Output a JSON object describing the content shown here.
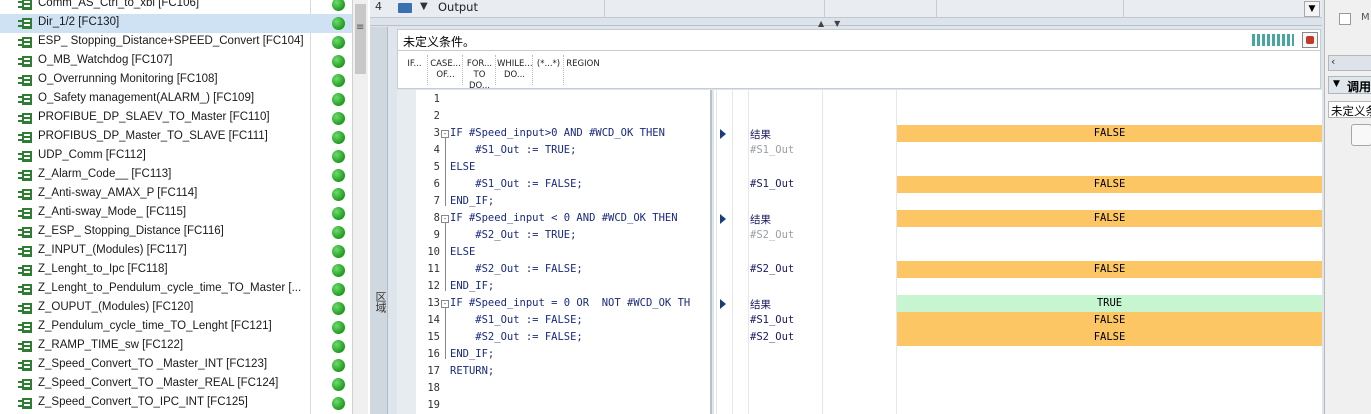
{
  "project_tree": {
    "items": [
      {
        "label": "Comm_AS_Ctrl_to_xbl [FC106]"
      },
      {
        "label": "Dir_1/2 [FC130]"
      },
      {
        "label": "ESP_ Stopping_Distance+SPEED_Convert [FC104]"
      },
      {
        "label": "O_MB_Watchdog [FC107]"
      },
      {
        "label": "O_Overrunning Monitoring [FC108]"
      },
      {
        "label": "O_Safety management(ALARM_) [FC109]"
      },
      {
        "label": "PROFIBUE_DP_SLAEV_TO_Master [FC110]"
      },
      {
        "label": "PROFIBUS_DP_Master_TO_SLAVE [FC111]"
      },
      {
        "label": "UDP_Comm [FC112]"
      },
      {
        "label": "Z_Alarm_Code__ [FC113]"
      },
      {
        "label": "Z_Anti-sway_AMAX_P [FC114]"
      },
      {
        "label": "Z_Anti-sway_Mode_ [FC115]"
      },
      {
        "label": "Z_ESP_ Stopping_Distance [FC116]"
      },
      {
        "label": "Z_INPUT_(Modules) [FC117]"
      },
      {
        "label": "Z_Lenght_to_Ipc [FC118]"
      },
      {
        "label": "Z_Lenght_to_Pendulum_cycle_time_TO_Master [..."
      },
      {
        "label": "Z_OUPUT_(Modules) [FC120]"
      },
      {
        "label": "Z_Pendulum_cycle_time_TO_Lenght [FC121]"
      },
      {
        "label": "Z_RAMP_TIME_sw [FC122]"
      },
      {
        "label": "Z_Speed_Convert_TO _Master_INT [FC123]"
      },
      {
        "label": "Z_Speed_Convert_TO _Master_REAL [FC124]"
      },
      {
        "label": "Z_Speed_Convert_TO_IPC_INT [FC125]"
      }
    ],
    "selected_index": 1,
    "status_color": "#1e9a1e",
    "block_icon": "function-block-icon"
  },
  "interface": {
    "row_number": "4",
    "section_label": "Output"
  },
  "editor": {
    "side_label": "区域",
    "block_comment": "未定义条件。",
    "instructions": [
      {
        "label": "IF..."
      },
      {
        "label": "CASE... OF..."
      },
      {
        "label": "FOR... TO DO..."
      },
      {
        "label": "WHILE... DO..."
      },
      {
        "label": "(*...*)"
      },
      {
        "label": "REGION"
      }
    ],
    "code_lines": [
      {
        "no": "1",
        "text": ""
      },
      {
        "no": "2",
        "text": ""
      },
      {
        "no": "3",
        "text": "IF #Speed_input>0 AND #WCD_OK THEN",
        "fold": "-"
      },
      {
        "no": "4",
        "text": "    #S1_Out := TRUE;"
      },
      {
        "no": "5",
        "text": "ELSE"
      },
      {
        "no": "6",
        "text": "    #S1_Out := FALSE;"
      },
      {
        "no": "7",
        "text": "END_IF;"
      },
      {
        "no": "8",
        "text": "IF #Speed_input < 0 AND #WCD_OK THEN",
        "fold": "-"
      },
      {
        "no": "9",
        "text": "    #S2_Out := TRUE;"
      },
      {
        "no": "10",
        "text": "ELSE"
      },
      {
        "no": "11",
        "text": "    #S2_Out := FALSE;"
      },
      {
        "no": "12",
        "text": "END_IF;"
      },
      {
        "no": "13",
        "text": "IF #Speed_input = 0 OR  NOT #WCD_OK TH",
        "fold": "-"
      },
      {
        "no": "14",
        "text": "    #S1_Out := FALSE;"
      },
      {
        "no": "15",
        "text": "    #S2_Out := FALSE;"
      },
      {
        "no": "16",
        "text": "END_IF;"
      },
      {
        "no": "17",
        "text": "RETURN;"
      },
      {
        "no": "18",
        "text": ""
      },
      {
        "no": "19",
        "text": ""
      }
    ]
  },
  "monitor": {
    "rows": [
      {
        "line": 3,
        "marker": true,
        "name": "结果",
        "value": "FALSE",
        "state": "false"
      },
      {
        "line": 4,
        "name": "#S1_Out",
        "grey": true
      },
      {
        "line": 6,
        "name": "#S1_Out",
        "value": "FALSE",
        "state": "false"
      },
      {
        "line": 8,
        "marker": true,
        "name": "结果",
        "value": "FALSE",
        "state": "false"
      },
      {
        "line": 9,
        "name": "#S2_Out",
        "grey": true
      },
      {
        "line": 11,
        "name": "#S2_Out",
        "value": "FALSE",
        "state": "false"
      },
      {
        "line": 13,
        "marker": true,
        "name": "结果",
        "value": "TRUE",
        "state": "true"
      },
      {
        "line": 14,
        "name": "#S1_Out",
        "value": "FALSE",
        "state": "false"
      },
      {
        "line": 15,
        "name": "#S2_Out",
        "value": "FALSE",
        "state": "false"
      }
    ],
    "false_color": "#fcc664",
    "true_color": "#c7f5cf"
  },
  "right_panel": {
    "checkbox_label": "M",
    "header": "调用",
    "field_value": "未定义条件"
  }
}
